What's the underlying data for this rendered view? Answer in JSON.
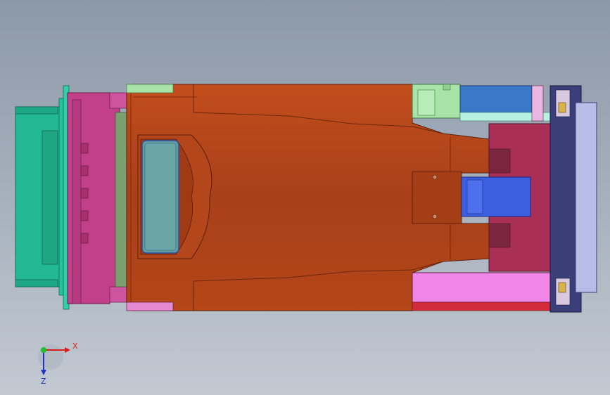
{
  "viewport": {
    "background_top": "#8c99a8",
    "background_bottom": "#c3c9d1"
  },
  "triad": {
    "x_label": "X",
    "y_label": "Y",
    "z_label": "Z",
    "x_color": "#d91e1e",
    "y_color": "#1fbf2a",
    "z_color": "#2234c8"
  },
  "model": {
    "view": "top",
    "colors": {
      "connector_teal": "#22b894",
      "magenta_body": "#c2408a",
      "orange_housing": "#b0411a",
      "window_teal": "#5f9ea0",
      "pale_green": "#a8e3a8",
      "steel_blue": "#3a78c8",
      "crimson_block": "#aa2f56",
      "royal_blue": "#3d5fe0",
      "lavender_cap": "#b8bde8",
      "pink_block": "#ef86e8"
    }
  }
}
